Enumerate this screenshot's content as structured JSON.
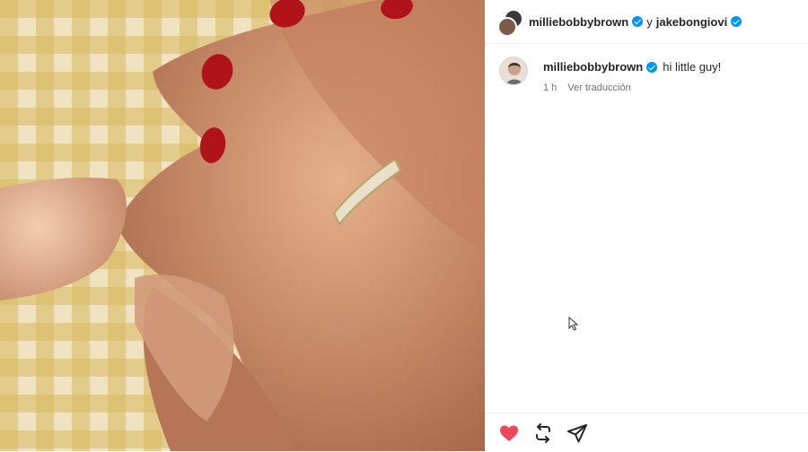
{
  "post": {
    "author": "milliebobbybrown",
    "joiner": "y",
    "coauthor": "jakebongiovi",
    "photo_alt": "hands with MOM ring"
  },
  "caption": {
    "username": "milliebobbybrown",
    "text": "hi little guy!",
    "time": "1 h",
    "translate_label": "Ver traducción"
  },
  "actions": {
    "icons": [
      "heart-icon",
      "repost-icon",
      "share-icon"
    ],
    "liked": true
  },
  "colors": {
    "verified": "#0095f6",
    "like": "#ed4956",
    "nail": "#b0141a"
  }
}
